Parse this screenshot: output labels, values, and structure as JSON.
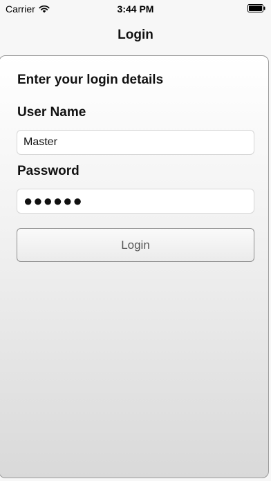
{
  "status_bar": {
    "carrier": "Carrier",
    "time": "3:44 PM",
    "wifi_icon": "wifi-icon",
    "battery_icon": "battery-full-icon"
  },
  "nav": {
    "title": "Login"
  },
  "form": {
    "heading": "Enter your login details",
    "username_label": "User Name",
    "username_value": "Master",
    "password_label": "Password",
    "password_value": "●●●●●●",
    "login_button": "Login"
  },
  "colors": {
    "background": "#f7f7f7",
    "card_border": "#9a9a9a",
    "button_text": "#555555"
  }
}
